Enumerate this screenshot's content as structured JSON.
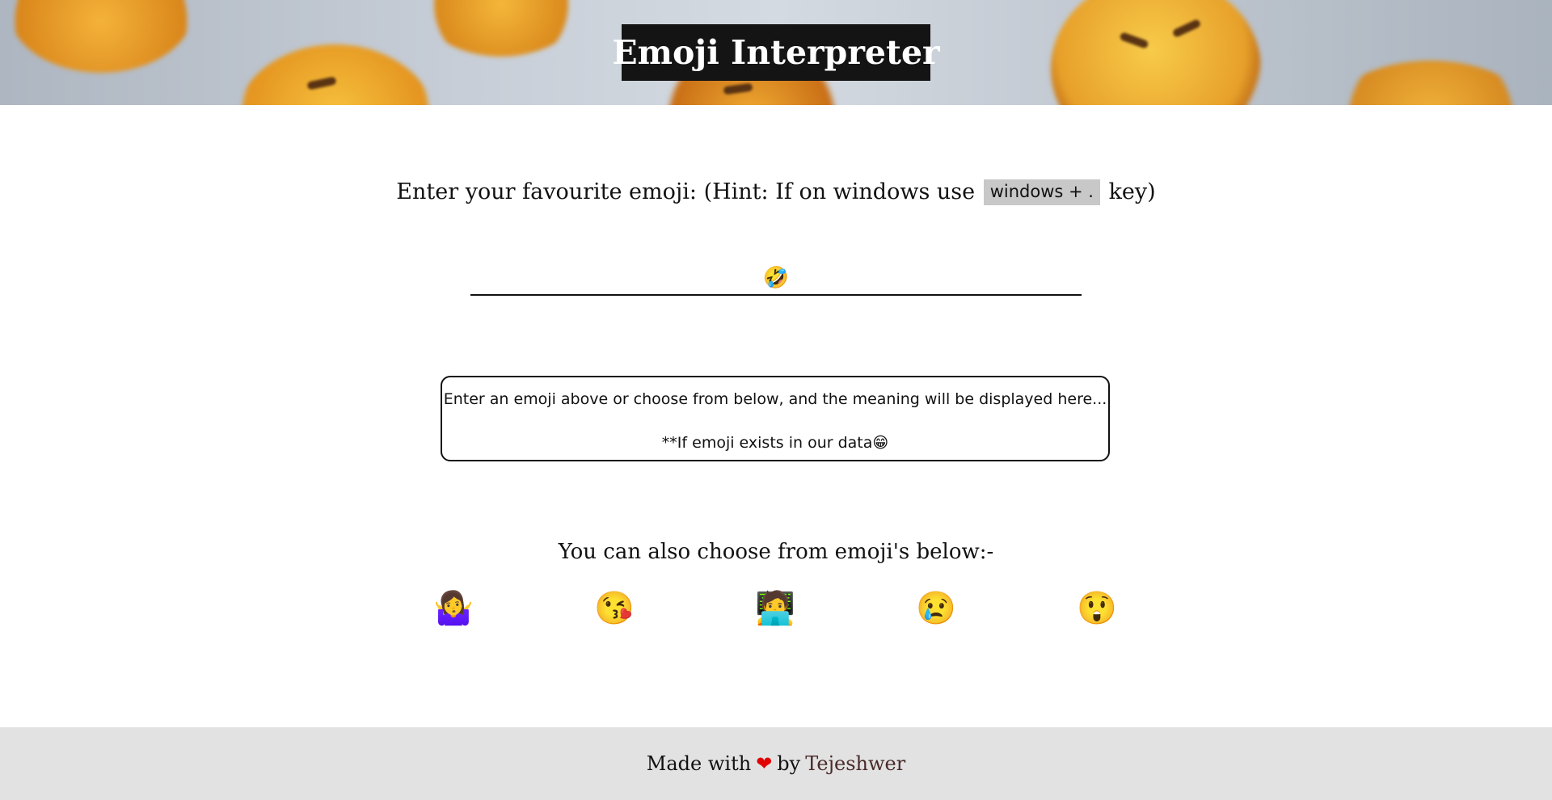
{
  "header": {
    "title": "Emoji Interpreter"
  },
  "prompt": {
    "text_before": "Enter your favourite emoji: (Hint: If on windows use",
    "key_hint": "windows + .",
    "text_after": "key)"
  },
  "input": {
    "value": "🤣",
    "placeholder": ""
  },
  "output": {
    "line1": "Enter an emoji above or choose from below, and the meaning will be displayed here...",
    "line2": "**If emoji exists in our data😁"
  },
  "choose_heading": "You can also choose from emoji's below:-",
  "emoji_options": [
    {
      "emoji": "🤷‍♀️",
      "name": "shrug"
    },
    {
      "emoji": "😘",
      "name": "kiss"
    },
    {
      "emoji": "🧑‍💻",
      "name": "technologist"
    },
    {
      "emoji": "😢",
      "name": "crying"
    },
    {
      "emoji": "😲",
      "name": "astonished"
    }
  ],
  "footer": {
    "made_with": "Made with",
    "heart": "❤",
    "by": "by",
    "author": "Tejeshwer"
  },
  "colors": {
    "title_bg": "#141414",
    "heart": "#e00000",
    "footer_bg": "#e2e2e2",
    "key_hint_bg": "#c8c8c8"
  }
}
